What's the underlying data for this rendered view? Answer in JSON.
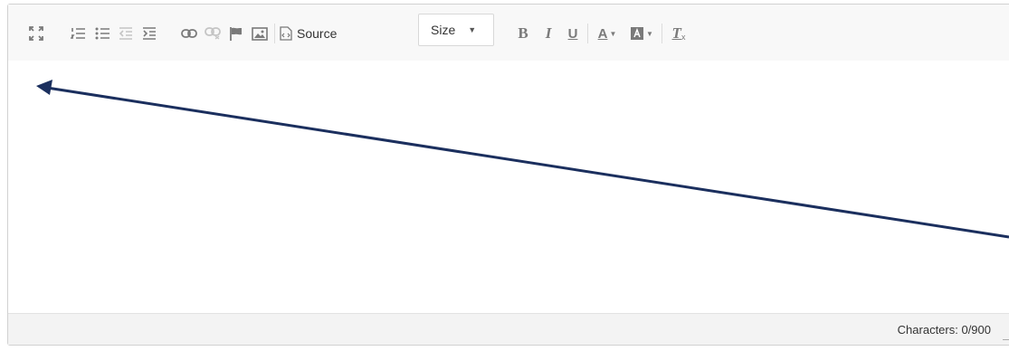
{
  "toolbar": {
    "maximize": "maximize-icon",
    "numbered_list": "numbered-list-icon",
    "bulleted_list": "bulleted-list-icon",
    "outdent": "outdent-icon",
    "indent": "indent-icon",
    "link": "link-icon",
    "unlink": "unlink-icon",
    "anchor": "anchor-flag-icon",
    "image": "image-icon",
    "source_label": "Source",
    "size_label": "Size",
    "bold_label": "B",
    "italic_label": "I",
    "underline_label": "U",
    "text_color_label": "A",
    "remove_format_label": "T",
    "remove_format_sub": "x"
  },
  "status": {
    "characters": "Characters: 0/900"
  },
  "annotation": {
    "arrow_color": "#1b2f5e"
  }
}
